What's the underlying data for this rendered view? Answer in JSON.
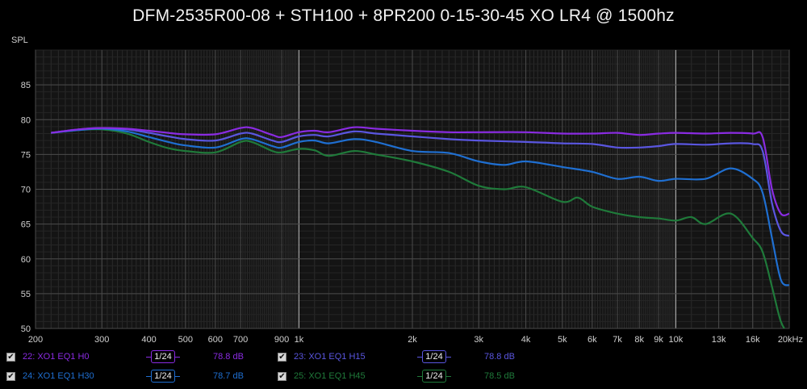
{
  "chart_data": {
    "type": "line",
    "title": "DFM-2535R00-08 + STH100 + 8PR200 0-15-30-45 XO LR4 @ 1500hz",
    "ylabel": "SPL",
    "xlabel": "",
    "x_scale": "log",
    "xlim": [
      200,
      20000
    ],
    "ylim": [
      50,
      90
    ],
    "x_ticks": [
      200,
      300,
      400,
      500,
      600,
      700,
      900,
      1000,
      2000,
      3000,
      4000,
      5000,
      6000,
      7000,
      8000,
      9000,
      10000,
      13000,
      16000,
      20000
    ],
    "x_tick_labels": [
      "200",
      "300",
      "400",
      "500",
      "600",
      "700",
      "900",
      "1k",
      "2k",
      "3k",
      "4k",
      "5k",
      "6k",
      "7k",
      "8k",
      "9k",
      "10k",
      "13k",
      "16k",
      "20kHz"
    ],
    "y_ticks": [
      50,
      55,
      60,
      65,
      70,
      75,
      80,
      85
    ],
    "y_tick_labels": [
      "50",
      "55",
      "60",
      "65",
      "70",
      "75",
      "80",
      "85"
    ],
    "grid": true,
    "legend_position": "bottom",
    "series": [
      {
        "name": "22: XO1 EQ1 H0",
        "smoothing": "1/24",
        "value": "78.8 dB",
        "color": "#8a2be2",
        "points": [
          [
            220,
            78.1
          ],
          [
            260,
            78.6
          ],
          [
            300,
            78.8
          ],
          [
            350,
            78.7
          ],
          [
            400,
            78.4
          ],
          [
            450,
            78.1
          ],
          [
            500,
            77.9
          ],
          [
            600,
            77.9
          ],
          [
            700,
            78.8
          ],
          [
            750,
            78.8
          ],
          [
            850,
            77.8
          ],
          [
            900,
            77.5
          ],
          [
            1000,
            78.2
          ],
          [
            1100,
            78.4
          ],
          [
            1200,
            78.2
          ],
          [
            1400,
            78.9
          ],
          [
            1600,
            78.7
          ],
          [
            2000,
            78.4
          ],
          [
            2500,
            78.2
          ],
          [
            3000,
            78.2
          ],
          [
            4000,
            78.2
          ],
          [
            5000,
            78.0
          ],
          [
            6000,
            78.0
          ],
          [
            7000,
            78.1
          ],
          [
            8000,
            77.8
          ],
          [
            9000,
            78.0
          ],
          [
            10000,
            78.1
          ],
          [
            12000,
            78.0
          ],
          [
            14000,
            78.1
          ],
          [
            16000,
            78.0
          ],
          [
            17000,
            77.5
          ],
          [
            18000,
            70.0
          ],
          [
            19000,
            66.5
          ],
          [
            20000,
            66.5
          ]
        ]
      },
      {
        "name": "23: XO1 EQ1 H15",
        "smoothing": "1/24",
        "value": "78.8 dB",
        "color": "#5a56e0",
        "points": [
          [
            220,
            78.1
          ],
          [
            260,
            78.6
          ],
          [
            300,
            78.8
          ],
          [
            350,
            78.6
          ],
          [
            400,
            78.1
          ],
          [
            450,
            77.6
          ],
          [
            500,
            77.2
          ],
          [
            600,
            77.0
          ],
          [
            700,
            78.0
          ],
          [
            750,
            78.0
          ],
          [
            850,
            77.0
          ],
          [
            900,
            76.8
          ],
          [
            1000,
            77.6
          ],
          [
            1100,
            77.8
          ],
          [
            1200,
            77.6
          ],
          [
            1400,
            78.3
          ],
          [
            1600,
            78.0
          ],
          [
            2000,
            77.6
          ],
          [
            2500,
            77.2
          ],
          [
            3000,
            77.0
          ],
          [
            4000,
            76.8
          ],
          [
            5000,
            76.6
          ],
          [
            6000,
            76.5
          ],
          [
            7000,
            76.0
          ],
          [
            8000,
            76.0
          ],
          [
            9000,
            76.2
          ],
          [
            10000,
            76.5
          ],
          [
            12000,
            76.4
          ],
          [
            14000,
            76.6
          ],
          [
            16000,
            76.5
          ],
          [
            17000,
            75.5
          ],
          [
            18000,
            68.0
          ],
          [
            19000,
            64.0
          ],
          [
            20000,
            63.3
          ]
        ]
      },
      {
        "name": "24: XO1 EQ1 H30",
        "smoothing": "1/24",
        "value": "78.7 dB",
        "color": "#1f6fd1",
        "points": [
          [
            220,
            78.1
          ],
          [
            260,
            78.5
          ],
          [
            300,
            78.7
          ],
          [
            350,
            78.3
          ],
          [
            400,
            77.5
          ],
          [
            450,
            76.8
          ],
          [
            500,
            76.3
          ],
          [
            600,
            76.0
          ],
          [
            700,
            77.2
          ],
          [
            750,
            77.2
          ],
          [
            850,
            76.2
          ],
          [
            900,
            76.0
          ],
          [
            1000,
            76.8
          ],
          [
            1100,
            77.0
          ],
          [
            1200,
            76.6
          ],
          [
            1400,
            77.2
          ],
          [
            1600,
            76.8
          ],
          [
            2000,
            75.5
          ],
          [
            2500,
            75.2
          ],
          [
            3000,
            74.0
          ],
          [
            3500,
            73.5
          ],
          [
            4000,
            74.0
          ],
          [
            5000,
            73.2
          ],
          [
            6000,
            72.5
          ],
          [
            7000,
            71.5
          ],
          [
            8000,
            71.8
          ],
          [
            9000,
            71.2
          ],
          [
            10000,
            71.5
          ],
          [
            12000,
            71.5
          ],
          [
            14000,
            73.0
          ],
          [
            16000,
            71.5
          ],
          [
            17000,
            69.5
          ],
          [
            18000,
            63.0
          ],
          [
            19000,
            57.0
          ],
          [
            20000,
            56.2
          ]
        ]
      },
      {
        "name": "25: XO1 EQ1 H45",
        "smoothing": "1/24",
        "value": "78.5 dB",
        "color": "#1f7a3a",
        "points": [
          [
            220,
            78.1
          ],
          [
            260,
            78.5
          ],
          [
            300,
            78.6
          ],
          [
            350,
            78.0
          ],
          [
            400,
            76.8
          ],
          [
            450,
            75.9
          ],
          [
            500,
            75.5
          ],
          [
            600,
            75.3
          ],
          [
            700,
            76.8
          ],
          [
            750,
            76.8
          ],
          [
            850,
            75.5
          ],
          [
            900,
            75.3
          ],
          [
            1000,
            75.8
          ],
          [
            1100,
            75.6
          ],
          [
            1200,
            74.8
          ],
          [
            1400,
            75.5
          ],
          [
            1600,
            75.0
          ],
          [
            2000,
            74.0
          ],
          [
            2500,
            72.5
          ],
          [
            3000,
            70.5
          ],
          [
            3500,
            70.0
          ],
          [
            4000,
            70.3
          ],
          [
            5000,
            68.2
          ],
          [
            5500,
            68.8
          ],
          [
            6000,
            67.5
          ],
          [
            7000,
            66.5
          ],
          [
            8000,
            66.0
          ],
          [
            9000,
            65.8
          ],
          [
            10000,
            65.5
          ],
          [
            11000,
            66.0
          ],
          [
            12000,
            65.0
          ],
          [
            14000,
            66.5
          ],
          [
            16000,
            63.0
          ],
          [
            17000,
            61.0
          ],
          [
            18000,
            56.0
          ],
          [
            19000,
            51.0
          ],
          [
            20000,
            49.0
          ]
        ]
      }
    ]
  }
}
